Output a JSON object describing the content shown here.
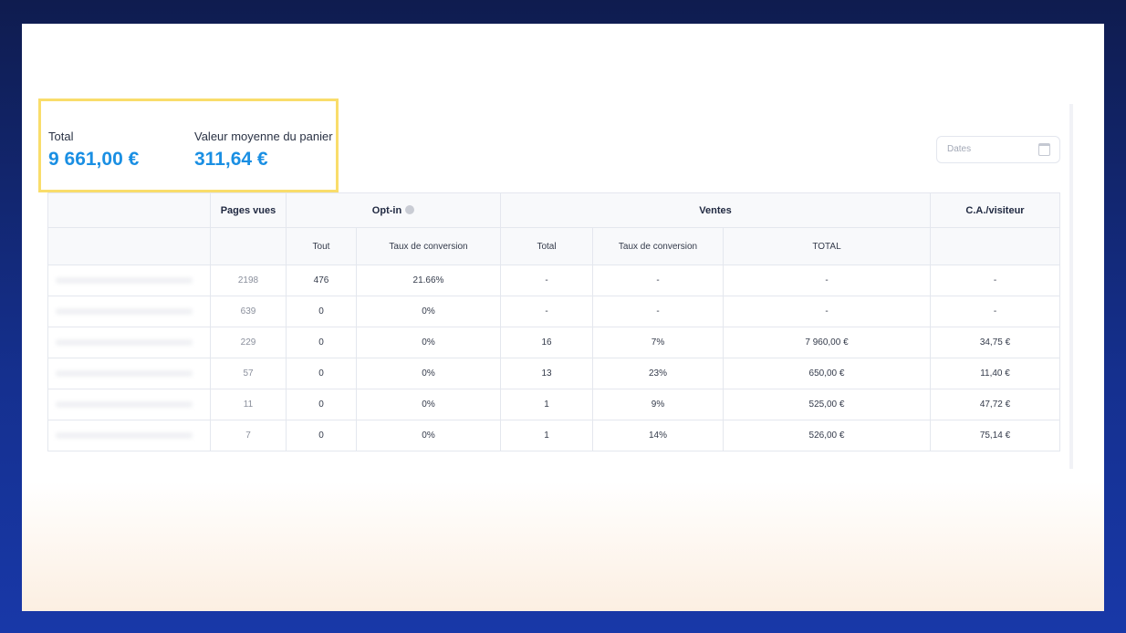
{
  "kpis": {
    "total_label": "Total",
    "total_value": "9 661,00 €",
    "avg_label": "Valeur moyenne du panier",
    "avg_value": "311,64 €"
  },
  "dates_placeholder": "Dates",
  "table": {
    "group_headers": {
      "pages_vues": "Pages vues",
      "optin": "Opt-in",
      "ventes": "Ventes",
      "ca_visiteur": "C.A./visiteur"
    },
    "sub_headers": {
      "optin_tout": "Tout",
      "optin_taux": "Taux de conversion",
      "ventes_total": "Total",
      "ventes_taux": "Taux de conversion",
      "ventes_TOTAL": "TOTAL"
    },
    "rows": [
      {
        "pages_vues": "2198",
        "optin_tout": "476",
        "optin_taux": "21.66%",
        "ventes_total": "-",
        "ventes_taux": "-",
        "ventes_montant": "-",
        "ca": "-"
      },
      {
        "pages_vues": "639",
        "optin_tout": "0",
        "optin_taux": "0%",
        "ventes_total": "-",
        "ventes_taux": "-",
        "ventes_montant": "-",
        "ca": "-"
      },
      {
        "pages_vues": "229",
        "optin_tout": "0",
        "optin_taux": "0%",
        "ventes_total": "16",
        "ventes_taux": "7%",
        "ventes_montant": "7 960,00 €",
        "ca": "34,75 €"
      },
      {
        "pages_vues": "57",
        "optin_tout": "0",
        "optin_taux": "0%",
        "ventes_total": "13",
        "ventes_taux": "23%",
        "ventes_montant": "650,00 €",
        "ca": "11,40 €"
      },
      {
        "pages_vues": "11",
        "optin_tout": "0",
        "optin_taux": "0%",
        "ventes_total": "1",
        "ventes_taux": "9%",
        "ventes_montant": "525,00 €",
        "ca": "47,72 €"
      },
      {
        "pages_vues": "7",
        "optin_tout": "0",
        "optin_taux": "0%",
        "ventes_total": "1",
        "ventes_taux": "14%",
        "ventes_montant": "526,00 €",
        "ca": "75,14 €"
      }
    ]
  }
}
